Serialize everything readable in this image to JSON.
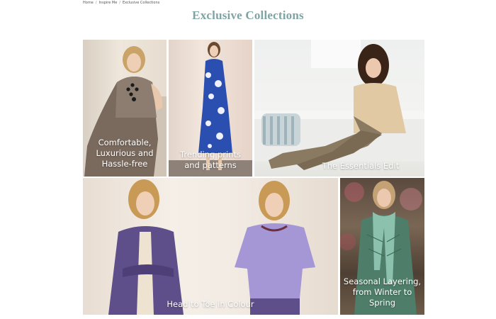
{
  "breadcrumb": {
    "items": [
      "Home",
      "Inspire Me",
      "Exclusive Collections"
    ],
    "separator": "/"
  },
  "page": {
    "title": "Exclusive Collections"
  },
  "tiles": [
    {
      "caption": "Comfortable, Luxurious and Hassle-free"
    },
    {
      "caption": "Trending prints and patterns"
    },
    {
      "caption": "The Essentials Edit"
    },
    {
      "caption": "Head to Toe in Colour"
    },
    {
      "caption": "Seasonal Layering, from Winter to Spring"
    }
  ],
  "colors": {
    "title": "#7fa4a4",
    "caption": "#ffffff"
  }
}
